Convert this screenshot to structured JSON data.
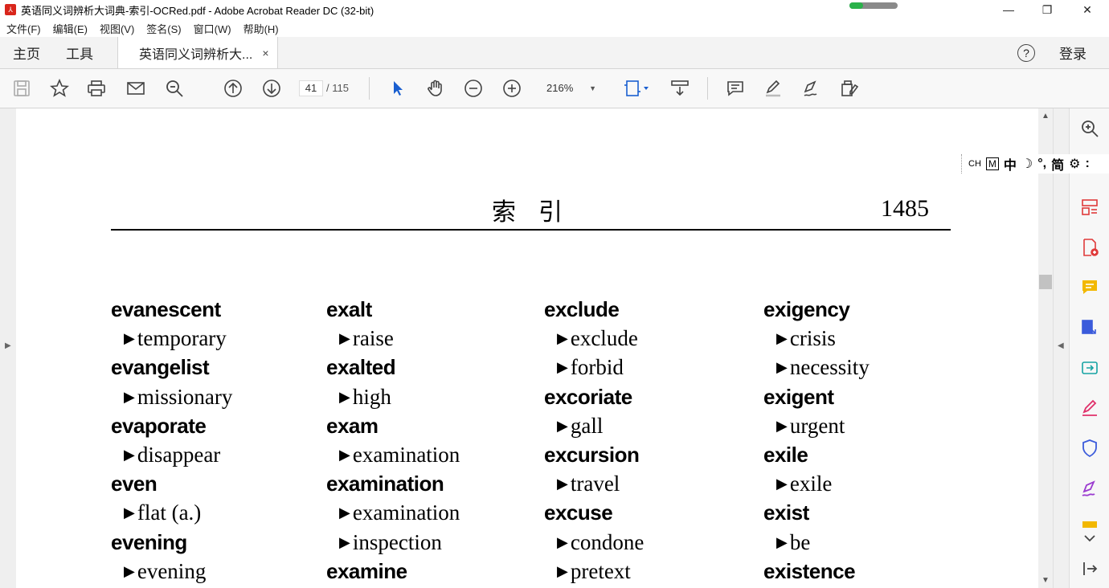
{
  "window": {
    "title": "英语同义词辨析大词典-索引-OCRed.pdf - Adobe Acrobat Reader DC (32-bit)",
    "minimize": "—",
    "maximize": "❐",
    "close": "✕",
    "loading_fraction": 0.28
  },
  "menubar": {
    "items": [
      "文件(F)",
      "编辑(E)",
      "视图(V)",
      "签名(S)",
      "窗口(W)",
      "帮助(H)"
    ]
  },
  "tabs": {
    "home": "主页",
    "tools": "工具",
    "document": "英语同义词辨析大...",
    "document_close": "×",
    "help": "?",
    "login": "登录"
  },
  "toolbar": {
    "current_page": "41",
    "total_pages": "/ 115",
    "zoom": "216%",
    "zoom_caret": "▼"
  },
  "ime": {
    "mode": "CH",
    "box": "M",
    "lang": "中",
    "moon": "☽",
    "punct": "°,",
    "script": "简",
    "gear": "⚙",
    "more": ":"
  },
  "page": {
    "header_title": "索引",
    "header_number": "1485",
    "columns": [
      [
        {
          "t": "head",
          "text": "evanescent"
        },
        {
          "t": "sub",
          "text": "temporary"
        },
        {
          "t": "head",
          "text": "evangelist"
        },
        {
          "t": "sub",
          "text": "missionary"
        },
        {
          "t": "head",
          "text": "evaporate"
        },
        {
          "t": "sub",
          "text": "disappear"
        },
        {
          "t": "head",
          "text": "even"
        },
        {
          "t": "sub",
          "text": "flat (a.)"
        },
        {
          "t": "head",
          "text": "evening"
        },
        {
          "t": "sub",
          "text": "evening"
        }
      ],
      [
        {
          "t": "head",
          "text": "exalt"
        },
        {
          "t": "sub",
          "text": "raise"
        },
        {
          "t": "head",
          "text": "exalted"
        },
        {
          "t": "sub",
          "text": "high"
        },
        {
          "t": "head",
          "text": "exam"
        },
        {
          "t": "sub",
          "text": "examination"
        },
        {
          "t": "head",
          "text": "examination"
        },
        {
          "t": "sub",
          "text": "examination"
        },
        {
          "t": "sub",
          "text": "inspection"
        },
        {
          "t": "head",
          "text": "examine"
        }
      ],
      [
        {
          "t": "head",
          "text": "exclude"
        },
        {
          "t": "sub",
          "text": "exclude"
        },
        {
          "t": "sub",
          "text": "forbid"
        },
        {
          "t": "head",
          "text": "excoriate"
        },
        {
          "t": "sub",
          "text": "gall"
        },
        {
          "t": "head",
          "text": "excursion"
        },
        {
          "t": "sub",
          "text": "travel"
        },
        {
          "t": "head",
          "text": "excuse"
        },
        {
          "t": "sub",
          "text": "condone"
        },
        {
          "t": "sub",
          "text": "pretext"
        }
      ],
      [
        {
          "t": "head",
          "text": "exigency"
        },
        {
          "t": "sub",
          "text": "crisis"
        },
        {
          "t": "sub",
          "text": "necessity"
        },
        {
          "t": "head",
          "text": "exigent"
        },
        {
          "t": "sub",
          "text": "urgent"
        },
        {
          "t": "head",
          "text": "exile"
        },
        {
          "t": "sub",
          "text": "exile"
        },
        {
          "t": "head",
          "text": "exist"
        },
        {
          "t": "sub",
          "text": "be"
        },
        {
          "t": "head",
          "text": "existence"
        }
      ]
    ]
  }
}
